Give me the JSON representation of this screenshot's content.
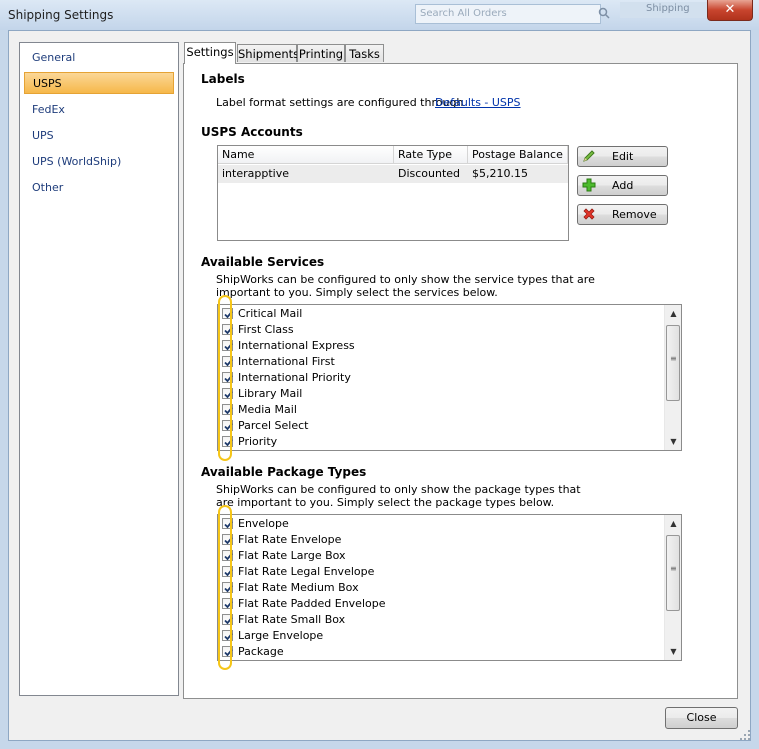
{
  "window": {
    "title": "Shipping Settings",
    "close_glyph": "✕",
    "bg_search_placeholder": "Search All Orders",
    "bg_fragment": "Shipping"
  },
  "sidebar": {
    "items": [
      {
        "label": "General"
      },
      {
        "label": "USPS"
      },
      {
        "label": "FedEx"
      },
      {
        "label": "UPS"
      },
      {
        "label": "UPS (WorldShip)"
      },
      {
        "label": "Other"
      }
    ],
    "selected": "USPS",
    "selected_color": "#f6b84a"
  },
  "tabs": [
    {
      "label": "Settings"
    },
    {
      "label": "Shipments"
    },
    {
      "label": "Printing"
    },
    {
      "label": "Tasks"
    }
  ],
  "labels_section": {
    "heading": "Labels",
    "text": "Label format settings are configured through",
    "link": "Defaults - USPS"
  },
  "accounts": {
    "heading": "USPS Accounts",
    "columns": [
      "Name",
      "Rate Type",
      "Postage Balance"
    ],
    "rows": [
      {
        "name": "interapptive",
        "rate_type": "Discounted",
        "balance": "$5,210.15"
      }
    ],
    "buttons": {
      "edit": "Edit",
      "add": "Add",
      "remove": "Remove"
    }
  },
  "services": {
    "heading": "Available Services",
    "description_1": "ShipWorks can be configured to only show the service types that are",
    "description_2": "important to you. Simply select the services below.",
    "items": [
      "Critical Mail",
      "First Class",
      "International Express",
      "International First",
      "International Priority",
      "Library Mail",
      "Media Mail",
      "Parcel Select",
      "Priority"
    ]
  },
  "packages": {
    "heading": "Available Package Types",
    "description_1": "ShipWorks can be configured to only show the package types that",
    "description_2": "are important to you. Simply select the package types below.",
    "items": [
      "Envelope",
      "Flat Rate Envelope",
      "Flat Rate Large Box",
      "Flat Rate Legal Envelope",
      "Flat Rate Medium Box",
      "Flat Rate Padded Envelope",
      "Flat Rate Small Box",
      "Large Envelope",
      "Package"
    ]
  },
  "footer": {
    "close_label": "Close"
  },
  "colors": {
    "highlight": "#f5c518",
    "link": "#0033aa"
  }
}
